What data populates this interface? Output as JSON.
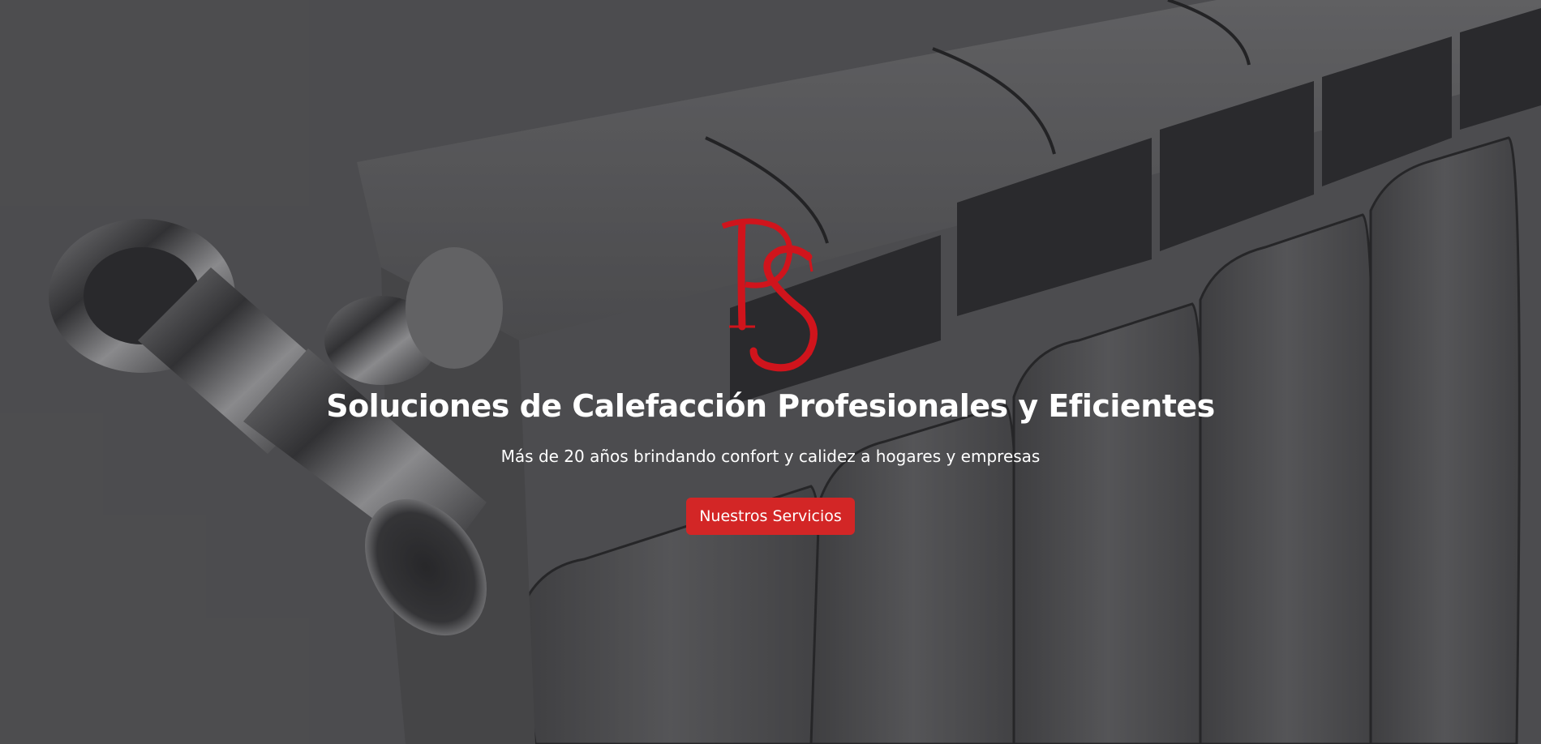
{
  "hero": {
    "background_image": "radiator-valve-photo",
    "logo": {
      "letters": "PS",
      "color": "#d0141c"
    },
    "title": "Soluciones de Calefacción Profesionales y Eficientes",
    "subtitle": "Más de 20 años brindando confort y calidez a hogares y empresas",
    "cta_label": "Nuestros Servicios",
    "cta_color": "#d32626"
  }
}
